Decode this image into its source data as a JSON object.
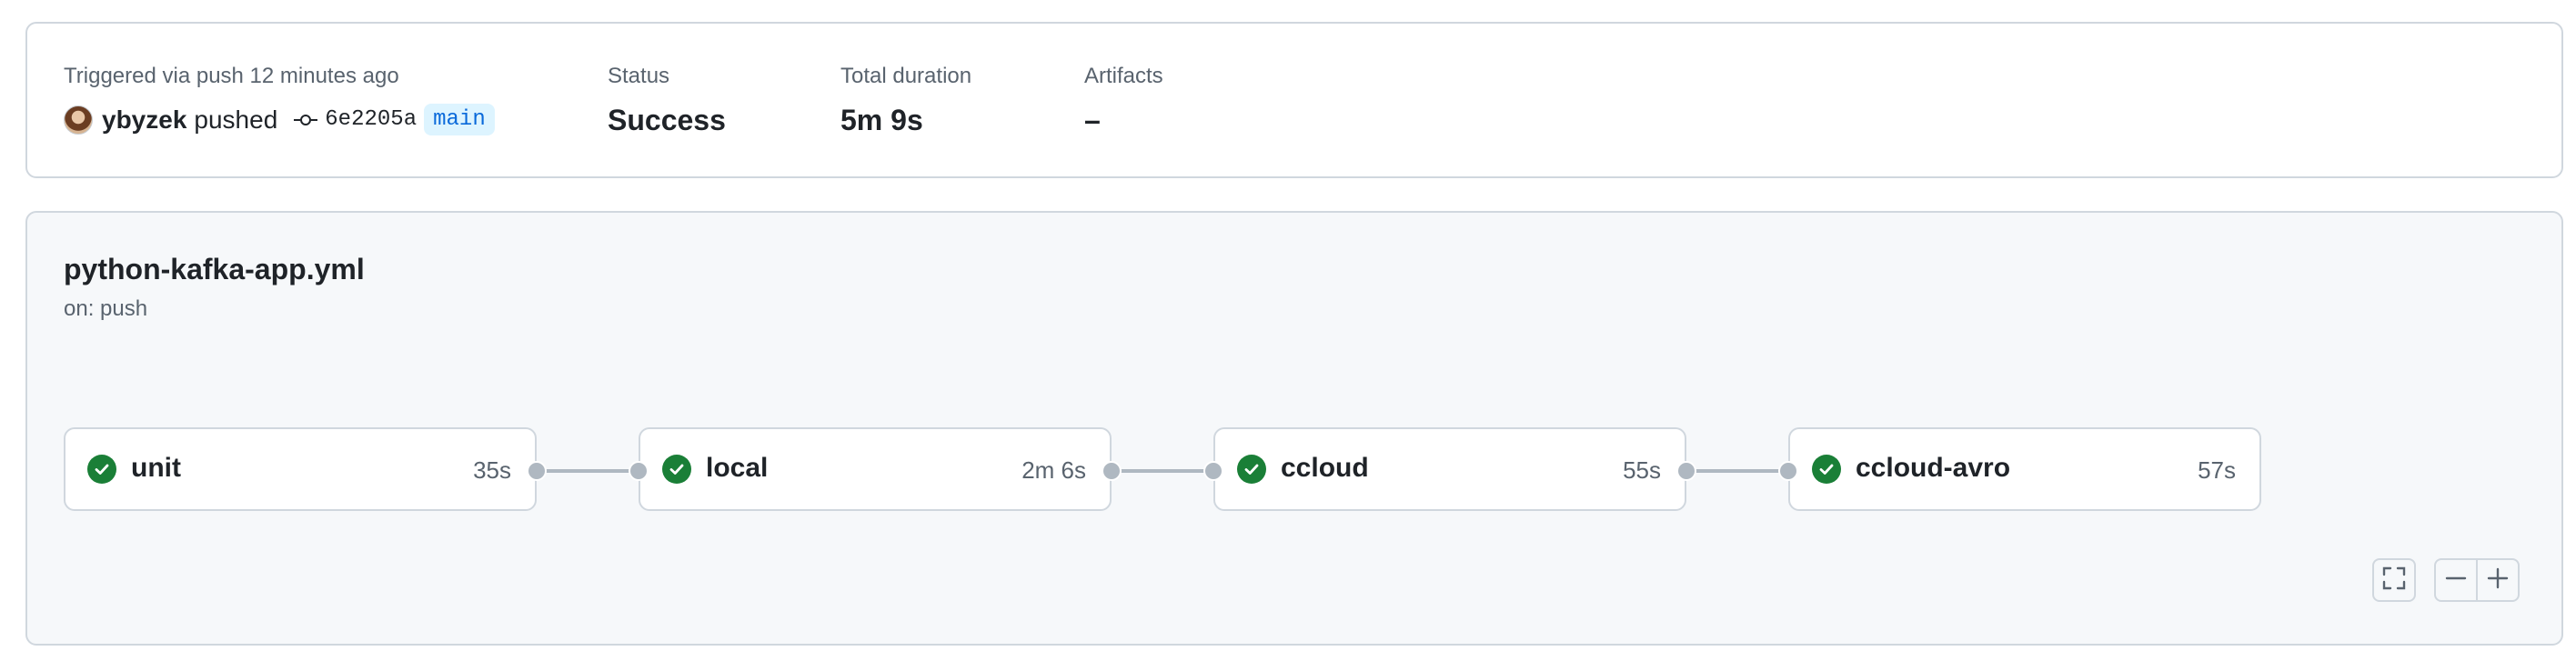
{
  "summary": {
    "trigger_label": "Triggered via push 12 minutes ago",
    "actor": "ybyzek",
    "action": "pushed",
    "commit_sha": "6e2205a",
    "branch": "main",
    "status_label": "Status",
    "status_value": "Success",
    "duration_label": "Total duration",
    "duration_value": "5m 9s",
    "artifacts_label": "Artifacts",
    "artifacts_value": "–"
  },
  "workflow": {
    "file_name": "python-kafka-app.yml",
    "trigger": "on: push",
    "jobs": [
      {
        "name": "unit",
        "duration": "35s",
        "status": "success"
      },
      {
        "name": "local",
        "duration": "2m 6s",
        "status": "success"
      },
      {
        "name": "ccloud",
        "duration": "55s",
        "status": "success"
      },
      {
        "name": "ccloud-avro",
        "duration": "57s",
        "status": "success"
      }
    ]
  },
  "controls": {
    "fullscreen_icon": "fullscreen-icon",
    "zoom_out_icon": "zoom-out-icon",
    "zoom_in_icon": "zoom-in-icon"
  },
  "colors": {
    "success": "#1a7f37",
    "branch_text": "#0969da",
    "branch_bg": "#ddf4ff",
    "border": "#d0d7de",
    "graph_bg": "#f6f8fa"
  }
}
